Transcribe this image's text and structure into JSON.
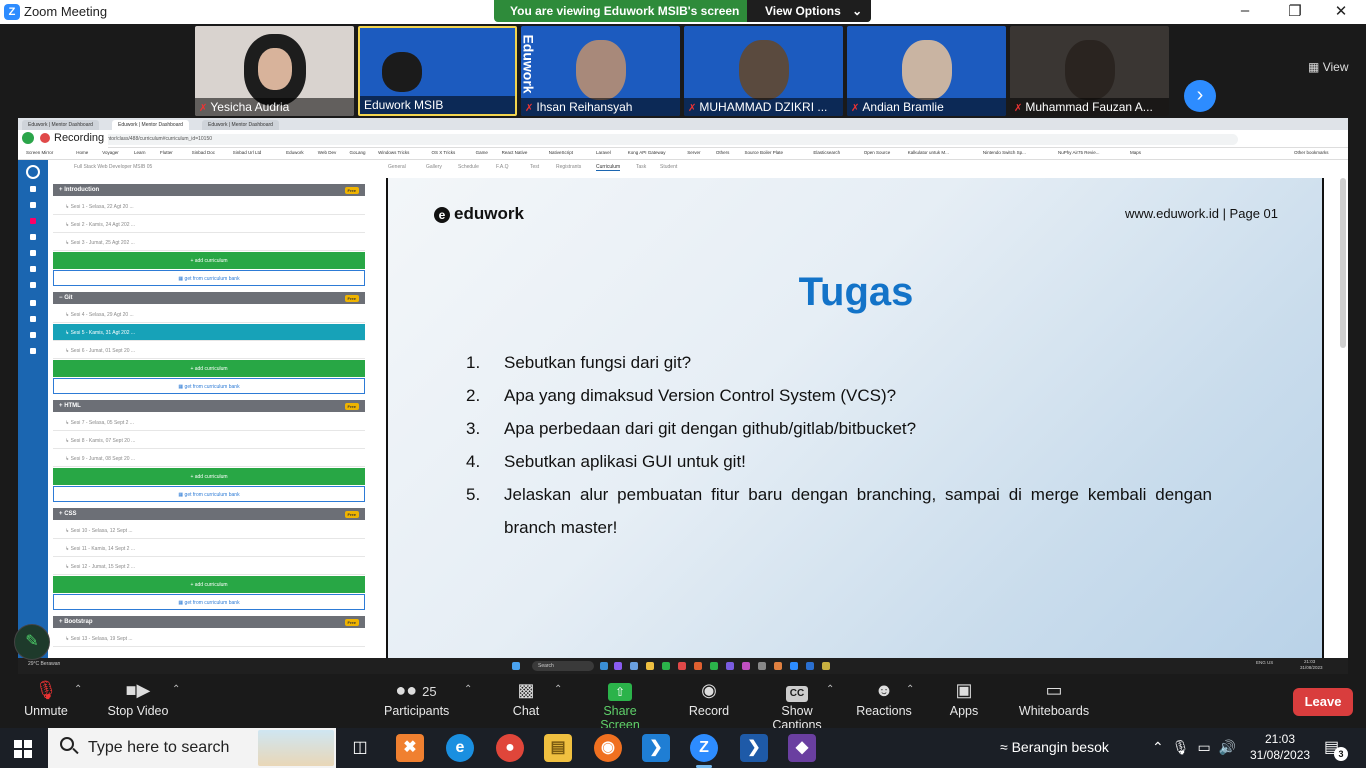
{
  "window": {
    "title": "Zoom Meeting"
  },
  "share_banner": {
    "message": "You are viewing Eduwork MSIB's screen",
    "view_options": "View Options"
  },
  "gallery": {
    "view_label": "View",
    "participants": [
      {
        "name": "Yesicha Audria",
        "muted": true
      },
      {
        "name": "Eduwork MSIB",
        "muted": false
      },
      {
        "name": "Ihsan Reihansyah",
        "muted": true
      },
      {
        "name": "MUHAMMAD DZIKRI ...",
        "muted": true
      },
      {
        "name": "Andian Bramlie",
        "muted": true
      },
      {
        "name": "Muhammad Fauzan A...",
        "muted": true
      }
    ],
    "wall_brand": "Eduwork"
  },
  "shared_screen": {
    "recording_label": "Recording",
    "browser_tabs": [
      "Eduwork | Mentor Dashboard",
      "Eduwork | Mentor Dashboard",
      "Eduwork | Mentor Dashboard"
    ],
    "url": "...mentor/class/488/curriculum#curriculum_id=10150",
    "bookmarks": [
      "Screen Mirror",
      "Home",
      "Voyager",
      "Learn",
      "Flutter",
      "Sinbad Doc",
      "Sinbad Url Ltd",
      "Eduwork",
      "Web Dev",
      "GoLang",
      "Windows Tricks",
      "OS X Tricks",
      "Game",
      "React Native",
      "NativeScript",
      "Laravel",
      "Kong API Gateway",
      "Server",
      "Others",
      "Source Boiler Plate",
      "Elasticsearch",
      "Open Source",
      "Kalkulator untuk M...",
      "Nintendo Switch Sp...",
      "NuPhy Air75 Revie...",
      "Maps",
      "Other bookmarks"
    ],
    "class_select": "Full Stack Web Developer MSIB 05",
    "subtabs": [
      "General",
      "Gallery",
      "Schedule",
      "F.A.Q",
      "Test",
      "Registrants",
      "Curriculum",
      "Task",
      "Student"
    ],
    "sections": [
      {
        "title": "Introduction",
        "badge": "Free",
        "items": [
          "Sesi 1 - Selasa, 22 Agt 20 ...",
          "Sesi 2 - Kamis, 24 Agt 202 ...",
          "Sesi 3 - Jumat, 25 Agt 202 ..."
        ]
      },
      {
        "title": "Git",
        "badge": "Free",
        "items": [
          "Sesi 4 - Selasa, 29 Agt 20 ...",
          "Sesi 5 - Kamis, 31 Agt 202 ...",
          "Sesi 6 - Jumat, 01 Sept 20 ..."
        ]
      },
      {
        "title": "HTML",
        "badge": "Free",
        "items": [
          "Sesi 7 - Selasa, 05 Sept 2 ...",
          "Sesi 8 - Kamis, 07 Sept 20 ...",
          "Sesi 9 - Jumat, 08 Sept 20 ..."
        ]
      },
      {
        "title": "CSS",
        "badge": "Free",
        "items": [
          "Sesi 10 - Selasa, 12 Sept ...",
          "Sesi 11 - Kamis, 14 Sept 2 ...",
          "Sesi 12 - Jumat, 15 Sept 2 ..."
        ]
      },
      {
        "title": "Bootstrap",
        "badge": "Free",
        "items": [
          "Sesi 13 - Selasa, 19 Sept ..."
        ]
      }
    ],
    "add_curriculum": "add curriculum",
    "get_from_bank": "get from curriculum bank",
    "slide": {
      "brand": "eduwork",
      "page": "www.eduwork.id | Page 01",
      "heading": "Tugas",
      "items": [
        {
          "n": "1.",
          "text": "Sebutkan fungsi dari git?"
        },
        {
          "n": "2.",
          "text": "Apa yang dimaksud Version Control System (VCS)?"
        },
        {
          "n": "3.",
          "text": "Apa perbedaan dari git dengan github/gitlab/bitbucket?"
        },
        {
          "n": "4.",
          "text": "Sebutkan aplikasi GUI untuk git!"
        },
        {
          "n": "5.",
          "text": "Jelaskan alur pembuatan fitur baru dengan branching, sampai di merge kembali dengan branch master!"
        }
      ]
    },
    "inner_taskbar": {
      "search": "Search",
      "weather": "29°C Berawan",
      "lang": "ENG US",
      "time": "21:03",
      "date": "31/08/2023"
    }
  },
  "controls": {
    "unmute": "Unmute",
    "stop_video": "Stop Video",
    "participants": "Participants",
    "participants_count": "25",
    "chat": "Chat",
    "share_screen": "Share Screen",
    "record": "Record",
    "show_captions": "Show Captions",
    "captions_icon": "CC",
    "reactions": "Reactions",
    "apps": "Apps",
    "whiteboards": "Whiteboards",
    "leave": "Leave"
  },
  "taskbar": {
    "search_placeholder": "Type here to search",
    "weather": "Berangin besok",
    "time": "21:03",
    "date": "31/08/2023",
    "notifications": "3"
  }
}
